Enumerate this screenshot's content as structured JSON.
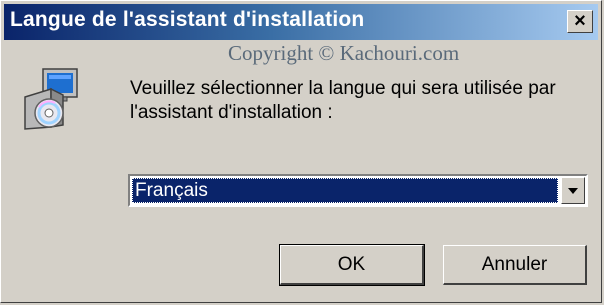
{
  "window": {
    "title": "Langue de l'assistant d'installation",
    "close_label": "×"
  },
  "watermark": "Copyright © Kachouri.com",
  "dialog": {
    "prompt": "Veuillez sélectionner la langue qui sera utilisée par l'assistant d'installation :",
    "icon": "installer-cd-computer-icon"
  },
  "language_select": {
    "selected": "Français"
  },
  "buttons": {
    "ok": "OK",
    "cancel": "Annuler"
  }
}
